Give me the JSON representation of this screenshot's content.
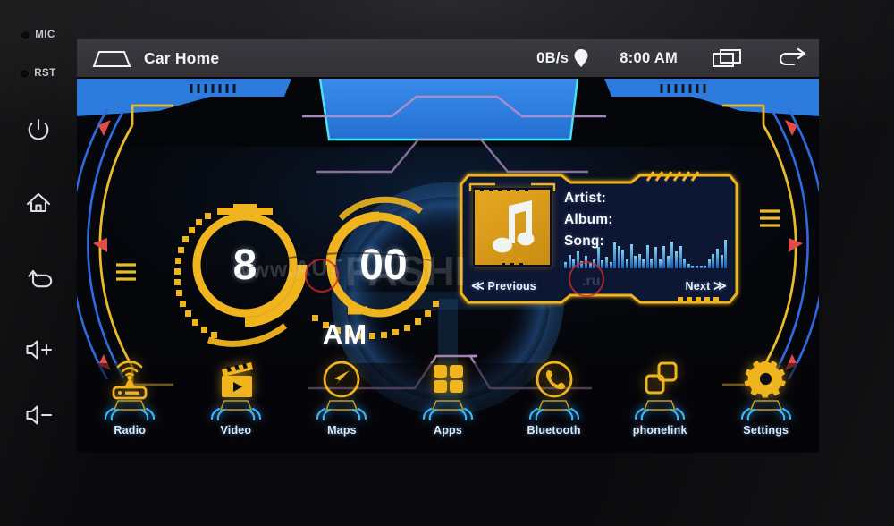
{
  "device": {
    "bezel_buttons": [
      {
        "name": "mic-indicator",
        "label": "MIC",
        "type": "dot-label"
      },
      {
        "name": "reset-indicator",
        "label": "RST",
        "type": "dot-label"
      },
      {
        "name": "power-button",
        "label": "power-icon",
        "type": "icon"
      },
      {
        "name": "home-button",
        "label": "home-icon",
        "type": "icon"
      },
      {
        "name": "back-button",
        "label": "back-arrow-icon",
        "type": "icon"
      },
      {
        "name": "volume-up",
        "label": "volume-up-icon",
        "type": "icon"
      },
      {
        "name": "volume-down",
        "label": "volume-down-icon",
        "type": "icon"
      }
    ]
  },
  "statusbar": {
    "home_icon": "car-home-outline-icon",
    "title": "Car Home",
    "network_speed": "0B/s",
    "location_icon": "location-pin-icon",
    "time": "8:00 AM",
    "recents_icon": "recent-apps-icon",
    "back_icon": "back-arrow-icon"
  },
  "clock": {
    "hours": "8",
    "minutes": "00",
    "meridiem": "AM"
  },
  "music": {
    "album_art_icon": "music-note-icon",
    "fields": [
      "Artist:",
      "Album:",
      "Song:"
    ],
    "prev_label": "Previous",
    "next_label": "Next",
    "prev_chevron": "≪",
    "next_chevron": "≫",
    "spectrum": [
      6,
      13,
      9,
      17,
      7,
      12,
      5,
      9,
      21,
      8,
      11,
      6,
      25,
      22,
      18,
      9,
      24,
      12,
      14,
      9,
      23,
      10,
      21,
      9,
      22,
      12,
      26,
      17,
      22,
      10,
      4,
      3,
      3,
      3,
      3,
      9,
      14,
      19,
      13,
      28
    ]
  },
  "dock": [
    {
      "label": "Radio",
      "icon": "radio-antenna-icon"
    },
    {
      "label": "Video",
      "icon": "clapperboard-icon"
    },
    {
      "label": "Maps",
      "icon": "navigation-compass-icon"
    },
    {
      "label": "Apps",
      "icon": "apps-grid-icon"
    },
    {
      "label": "Bluetooth",
      "icon": "phone-circle-icon"
    },
    {
      "label": "phonelink",
      "icon": "phone-link-icon"
    },
    {
      "label": "Settings",
      "icon": "gear-icon"
    }
  ],
  "watermark": {
    "prefix": "www.AUT",
    "main": "FASHI",
    "suffix": ".ru"
  },
  "colors": {
    "accent_amber": "#f0b41e",
    "hud_blue": "#2b6fd6",
    "windshield_blue": "#2e7fe0",
    "cyan_edge": "#49e4f2",
    "purple_line": "#b08fc8",
    "red_marker": "#e24b4b",
    "text_white": "#f4f6f8",
    "status_bar": "#3a3b40",
    "lcd_black": "#05060a"
  }
}
